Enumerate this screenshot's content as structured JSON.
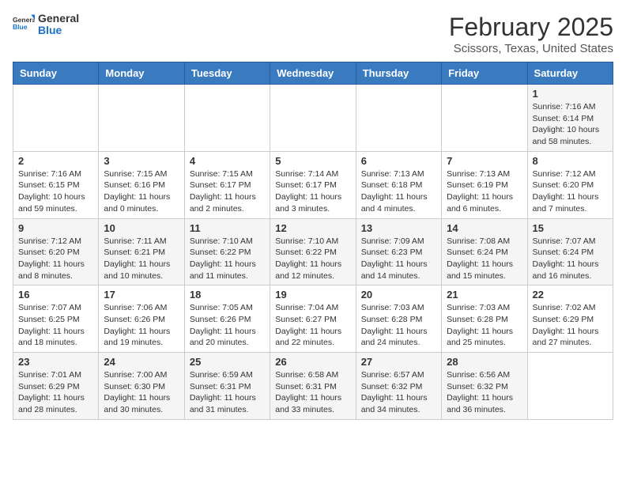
{
  "header": {
    "logo_general": "General",
    "logo_blue": "Blue",
    "month_year": "February 2025",
    "location": "Scissors, Texas, United States"
  },
  "days_of_week": [
    "Sunday",
    "Monday",
    "Tuesday",
    "Wednesday",
    "Thursday",
    "Friday",
    "Saturday"
  ],
  "weeks": [
    [
      {
        "day": "",
        "info": ""
      },
      {
        "day": "",
        "info": ""
      },
      {
        "day": "",
        "info": ""
      },
      {
        "day": "",
        "info": ""
      },
      {
        "day": "",
        "info": ""
      },
      {
        "day": "",
        "info": ""
      },
      {
        "day": "1",
        "info": "Sunrise: 7:16 AM\nSunset: 6:14 PM\nDaylight: 10 hours\nand 58 minutes."
      }
    ],
    [
      {
        "day": "2",
        "info": "Sunrise: 7:16 AM\nSunset: 6:15 PM\nDaylight: 10 hours\nand 59 minutes."
      },
      {
        "day": "3",
        "info": "Sunrise: 7:15 AM\nSunset: 6:16 PM\nDaylight: 11 hours\nand 0 minutes."
      },
      {
        "day": "4",
        "info": "Sunrise: 7:15 AM\nSunset: 6:17 PM\nDaylight: 11 hours\nand 2 minutes."
      },
      {
        "day": "5",
        "info": "Sunrise: 7:14 AM\nSunset: 6:17 PM\nDaylight: 11 hours\nand 3 minutes."
      },
      {
        "day": "6",
        "info": "Sunrise: 7:13 AM\nSunset: 6:18 PM\nDaylight: 11 hours\nand 4 minutes."
      },
      {
        "day": "7",
        "info": "Sunrise: 7:13 AM\nSunset: 6:19 PM\nDaylight: 11 hours\nand 6 minutes."
      },
      {
        "day": "8",
        "info": "Sunrise: 7:12 AM\nSunset: 6:20 PM\nDaylight: 11 hours\nand 7 minutes."
      }
    ],
    [
      {
        "day": "9",
        "info": "Sunrise: 7:12 AM\nSunset: 6:20 PM\nDaylight: 11 hours\nand 8 minutes."
      },
      {
        "day": "10",
        "info": "Sunrise: 7:11 AM\nSunset: 6:21 PM\nDaylight: 11 hours\nand 10 minutes."
      },
      {
        "day": "11",
        "info": "Sunrise: 7:10 AM\nSunset: 6:22 PM\nDaylight: 11 hours\nand 11 minutes."
      },
      {
        "day": "12",
        "info": "Sunrise: 7:10 AM\nSunset: 6:22 PM\nDaylight: 11 hours\nand 12 minutes."
      },
      {
        "day": "13",
        "info": "Sunrise: 7:09 AM\nSunset: 6:23 PM\nDaylight: 11 hours\nand 14 minutes."
      },
      {
        "day": "14",
        "info": "Sunrise: 7:08 AM\nSunset: 6:24 PM\nDaylight: 11 hours\nand 15 minutes."
      },
      {
        "day": "15",
        "info": "Sunrise: 7:07 AM\nSunset: 6:24 PM\nDaylight: 11 hours\nand 16 minutes."
      }
    ],
    [
      {
        "day": "16",
        "info": "Sunrise: 7:07 AM\nSunset: 6:25 PM\nDaylight: 11 hours\nand 18 minutes."
      },
      {
        "day": "17",
        "info": "Sunrise: 7:06 AM\nSunset: 6:26 PM\nDaylight: 11 hours\nand 19 minutes."
      },
      {
        "day": "18",
        "info": "Sunrise: 7:05 AM\nSunset: 6:26 PM\nDaylight: 11 hours\nand 20 minutes."
      },
      {
        "day": "19",
        "info": "Sunrise: 7:04 AM\nSunset: 6:27 PM\nDaylight: 11 hours\nand 22 minutes."
      },
      {
        "day": "20",
        "info": "Sunrise: 7:03 AM\nSunset: 6:28 PM\nDaylight: 11 hours\nand 24 minutes."
      },
      {
        "day": "21",
        "info": "Sunrise: 7:03 AM\nSunset: 6:28 PM\nDaylight: 11 hours\nand 25 minutes."
      },
      {
        "day": "22",
        "info": "Sunrise: 7:02 AM\nSunset: 6:29 PM\nDaylight: 11 hours\nand 27 minutes."
      }
    ],
    [
      {
        "day": "23",
        "info": "Sunrise: 7:01 AM\nSunset: 6:29 PM\nDaylight: 11 hours\nand 28 minutes."
      },
      {
        "day": "24",
        "info": "Sunrise: 7:00 AM\nSunset: 6:30 PM\nDaylight: 11 hours\nand 30 minutes."
      },
      {
        "day": "25",
        "info": "Sunrise: 6:59 AM\nSunset: 6:31 PM\nDaylight: 11 hours\nand 31 minutes."
      },
      {
        "day": "26",
        "info": "Sunrise: 6:58 AM\nSunset: 6:31 PM\nDaylight: 11 hours\nand 33 minutes."
      },
      {
        "day": "27",
        "info": "Sunrise: 6:57 AM\nSunset: 6:32 PM\nDaylight: 11 hours\nand 34 minutes."
      },
      {
        "day": "28",
        "info": "Sunrise: 6:56 AM\nSunset: 6:32 PM\nDaylight: 11 hours\nand 36 minutes."
      },
      {
        "day": "",
        "info": ""
      }
    ]
  ]
}
